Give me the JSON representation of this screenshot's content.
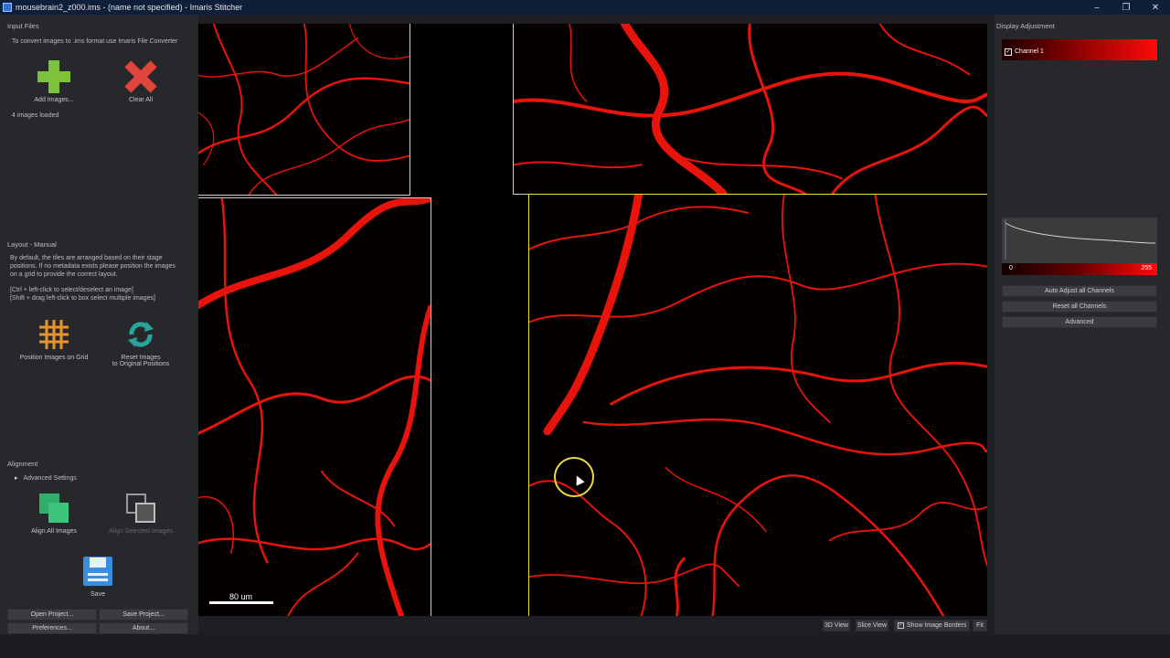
{
  "window": {
    "title": "mousebrain2_z000.ims - (name not specified) - Imaris Stitcher"
  },
  "input_files": {
    "title": "Input Files",
    "hint": "To convert images to .ims format use Imaris File Converter",
    "add_label": "Add Images...",
    "clear_label": "Clear All",
    "status": "4 images loaded"
  },
  "layout": {
    "title": "Layout - Manual",
    "desc1": "By default, the tiles are arranged based on their stage",
    "desc2": "positions. If no metadata exists please position the images",
    "desc3": "on a grid to provide the correct layout.",
    "hint1": "[Ctrl + left-click to select/deselect an image]",
    "hint2": "[Shift + drag left-click to box select multiple images]",
    "position_label": "Position Images on Grid",
    "reset_label1": "Reset Images",
    "reset_label2": "to Original Positions"
  },
  "alignment": {
    "title": "Alignment",
    "advanced_label": "Advanced Settings",
    "align_all_label": "Align All Images",
    "align_selected_label": "Align Selected Images"
  },
  "save_label": "Save",
  "bottom_buttons": {
    "open": "Open Project...",
    "save_project": "Save Project...",
    "preferences": "Preferences...",
    "about": "About..."
  },
  "viewer": {
    "scale_label": "80 um"
  },
  "display": {
    "title": "Display Adjustment",
    "channel_label": "Channel 1",
    "range_min": "0",
    "range_max": "255",
    "auto_adjust": "Auto Adjust all Channels",
    "reset": "Reset all Channels",
    "advanced": "Advanced"
  },
  "view_buttons": {
    "view3d": "3D View",
    "slice": "Slice View",
    "borders": "Show Image Borders",
    "fit": "Fit"
  },
  "colors": {
    "vessel": "#e8140c",
    "selected_border": "#e9e24a",
    "accent_green": "#7ec13a",
    "accent_red": "#e0443a"
  }
}
